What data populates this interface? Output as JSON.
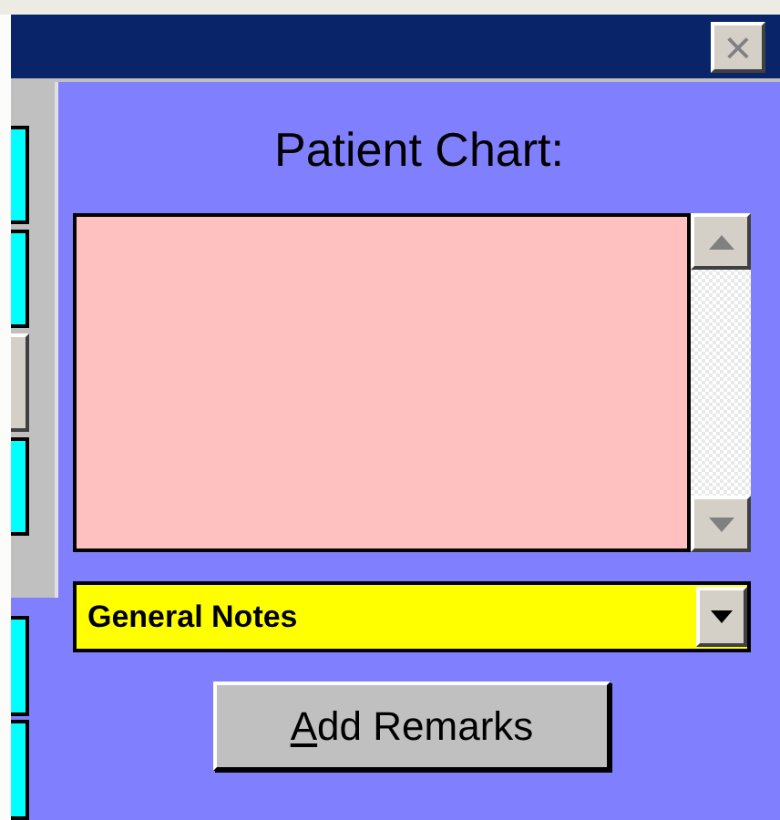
{
  "window": {
    "close_button": "×"
  },
  "left_panel": {
    "items": [
      {
        "kind": "field"
      },
      {
        "kind": "field"
      },
      {
        "kind": "button"
      },
      {
        "kind": "field"
      }
    ],
    "lower_items": [
      {
        "kind": "field"
      },
      {
        "kind": "field"
      }
    ]
  },
  "chart_panel": {
    "title": "Patient Chart:",
    "category_dropdown": {
      "value": "General Notes"
    },
    "add_button": {
      "label": "Add Remarks"
    }
  }
}
